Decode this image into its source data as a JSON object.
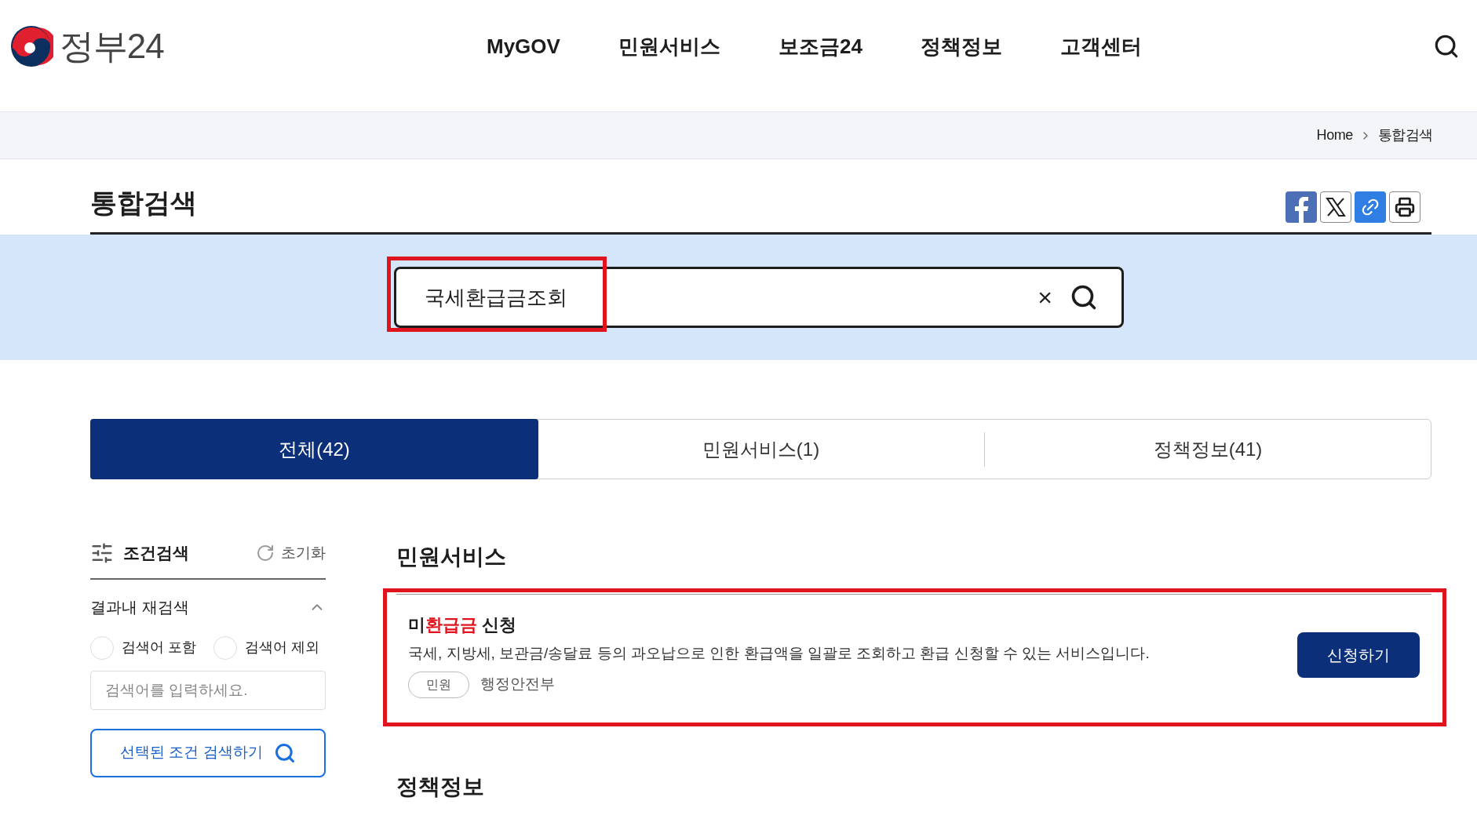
{
  "header": {
    "logo_text": "정부24",
    "nav": [
      "MyGOV",
      "민원서비스",
      "보조금24",
      "정책정보",
      "고객센터"
    ]
  },
  "breadcrumb": [
    "Home",
    "통합검색"
  ],
  "page_title": "통합검색",
  "search": {
    "value": "국세환급금조회",
    "clear": "×"
  },
  "tabs": [
    {
      "label": "전체(42)",
      "selected": true
    },
    {
      "label": "민원서비스(1)",
      "selected": false
    },
    {
      "label": "정책정보(41)",
      "selected": false
    }
  ],
  "sidebar": {
    "title": "조건검색",
    "reset": "초기화",
    "section": "결과내 재검색",
    "expanded": true,
    "options": [
      {
        "label": "검색어 포함",
        "selected": false
      },
      {
        "label": "검색어 제외",
        "selected": false
      }
    ],
    "field": {
      "placeholder": "검색어를 입력하세요."
    },
    "button": "선택된 조건 검색하기"
  },
  "sections": [
    {
      "title": "민원서비스",
      "results": [
        {
          "title": {
            "before": "미",
            "match": "환급금",
            "after": " 신청"
          },
          "description": "국세, 지방세, 보관금/송달료 등의 과오납으로 인한 환급액을 일괄로 조회하고 환급 신청할 수 있는 서비스입니다.",
          "tag": "민원",
          "agency": "행정안전부",
          "button": "신청하기"
        }
      ]
    },
    {
      "title": "정책정보"
    }
  ]
}
